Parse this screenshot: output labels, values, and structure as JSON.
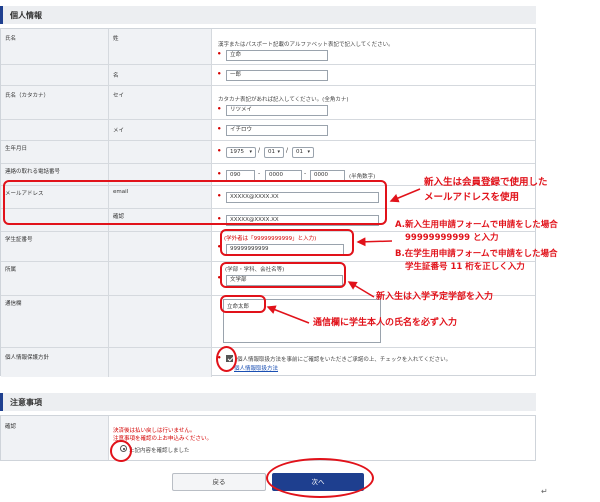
{
  "personal": {
    "header": "個人情報",
    "name": {
      "label": "氏名",
      "note": "漢字またはパスポート記載のアルファベット表記で記入してください。",
      "sei_label": "姓",
      "sei_value": "立命",
      "mei_label": "名",
      "mei_value": "一郎"
    },
    "kana": {
      "label": "氏名（カタカナ）",
      "note": "カタカナ表記があれば記入してください。(全角カナ)",
      "sei_label": "セイ",
      "sei_value": "リツメイ",
      "mei_label": "メイ",
      "mei_value": "イチロウ"
    },
    "birth": {
      "label": "生年月日",
      "year": "1975",
      "month": "01",
      "day": "01"
    },
    "phone": {
      "label": "連絡の取れる電話番号",
      "part1": "090",
      "part2": "0000",
      "part3": "0000",
      "note": "(半角数字)"
    },
    "email": {
      "label": "メールアドレス",
      "email_label": "email",
      "email_value": "XXXXX@XXXX.XX",
      "confirm_label": "確認",
      "confirm_value": "XXXXX@XXXX.XX"
    },
    "student_id": {
      "label": "学生証番号",
      "hint": "(学外者は「99999999999」と入力)",
      "value": "99999999999"
    },
    "affiliation": {
      "label": "所属",
      "hint": "(学部・学科、会社名等)",
      "value": "文学部"
    },
    "message": {
      "label": "通信欄",
      "value": "立命太郎"
    },
    "privacy": {
      "label": "個人情報保護方針",
      "text": "個人情報取扱方法を事前にご確認をいただきご承諾の上、チェックを入れてください。",
      "link": "個人情報取扱方法"
    }
  },
  "notice": {
    "header": "注意事項",
    "confirm_label": "確認",
    "line1": "決済後は払い戻しは行いません。",
    "line2": "注意事項を確認の上お申込みください。",
    "radio_label": "上記内容を確認しました"
  },
  "buttons": {
    "back": "戻る",
    "next": "次へ"
  },
  "annotations": {
    "email": [
      "新入生は会員登録で使用した",
      "メールアドレスを使用"
    ],
    "student_id": [
      "A.新入生用申請フォームで申請をした場合",
      "99999999999 と入力",
      "B.在学生用申請フォームで申請をした場合",
      "学生証番号 11 桁を正しく入力"
    ],
    "affiliation": "新入生は入学予定学部を入力",
    "message": "通信欄に学生本人の氏名を必ず入力"
  },
  "colors": {
    "accent": "#1e3f8f",
    "annotation": "#e1121a",
    "required": "#d40000"
  },
  "icons": [
    "chevron-down-icon",
    "checkbox-icon",
    "radio-icon",
    "arrow-icon"
  ]
}
